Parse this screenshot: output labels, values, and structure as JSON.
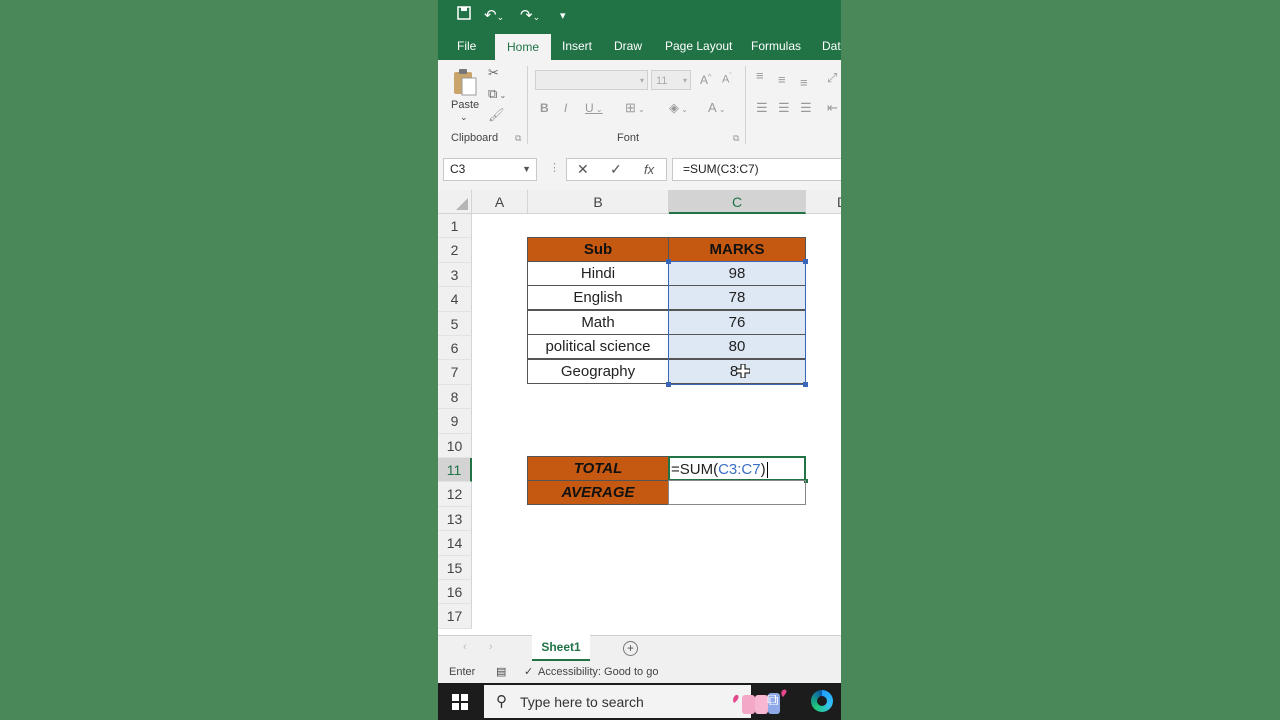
{
  "ribbon_tabs": [
    "File",
    "Home",
    "Insert",
    "Draw",
    "Page Layout",
    "Formulas",
    "Data"
  ],
  "ribbon": {
    "paste_label": "Paste",
    "clipboard_label": "Clipboard",
    "font_label": "Font",
    "font_size": "11"
  },
  "formula_bar": {
    "name_box": "C3",
    "fx": "fx",
    "formula": "=SUM(C3:C7)"
  },
  "columns": [
    "A",
    "B",
    "C",
    "D"
  ],
  "rows": [
    "1",
    "2",
    "3",
    "4",
    "5",
    "6",
    "7",
    "8",
    "9",
    "10",
    "11",
    "12",
    "13",
    "14",
    "15",
    "16",
    "17"
  ],
  "table": {
    "header_sub": "Sub",
    "header_marks": "MARKS",
    "rows": [
      {
        "sub": "Hindi",
        "marks": "98"
      },
      {
        "sub": "English",
        "marks": "78"
      },
      {
        "sub": "Math",
        "marks": "76"
      },
      {
        "sub": "political science",
        "marks": "80"
      },
      {
        "sub": "Geography",
        "marks": "8"
      }
    ]
  },
  "summary": {
    "total_label": "TOTAL",
    "average_label": "AVERAGE",
    "edit_prefix": "=SUM(",
    "edit_ref": "C3:C7",
    "edit_suffix": ")"
  },
  "sheet_tab": "Sheet1",
  "status": {
    "mode": "Enter",
    "accessibility": "Accessibility: Good to go"
  },
  "taskbar": {
    "search_placeholder": "Type here to search"
  },
  "colors": {
    "excel_green": "#217346",
    "header_orange": "#c65911",
    "selection_blue": "#3a66b8"
  }
}
